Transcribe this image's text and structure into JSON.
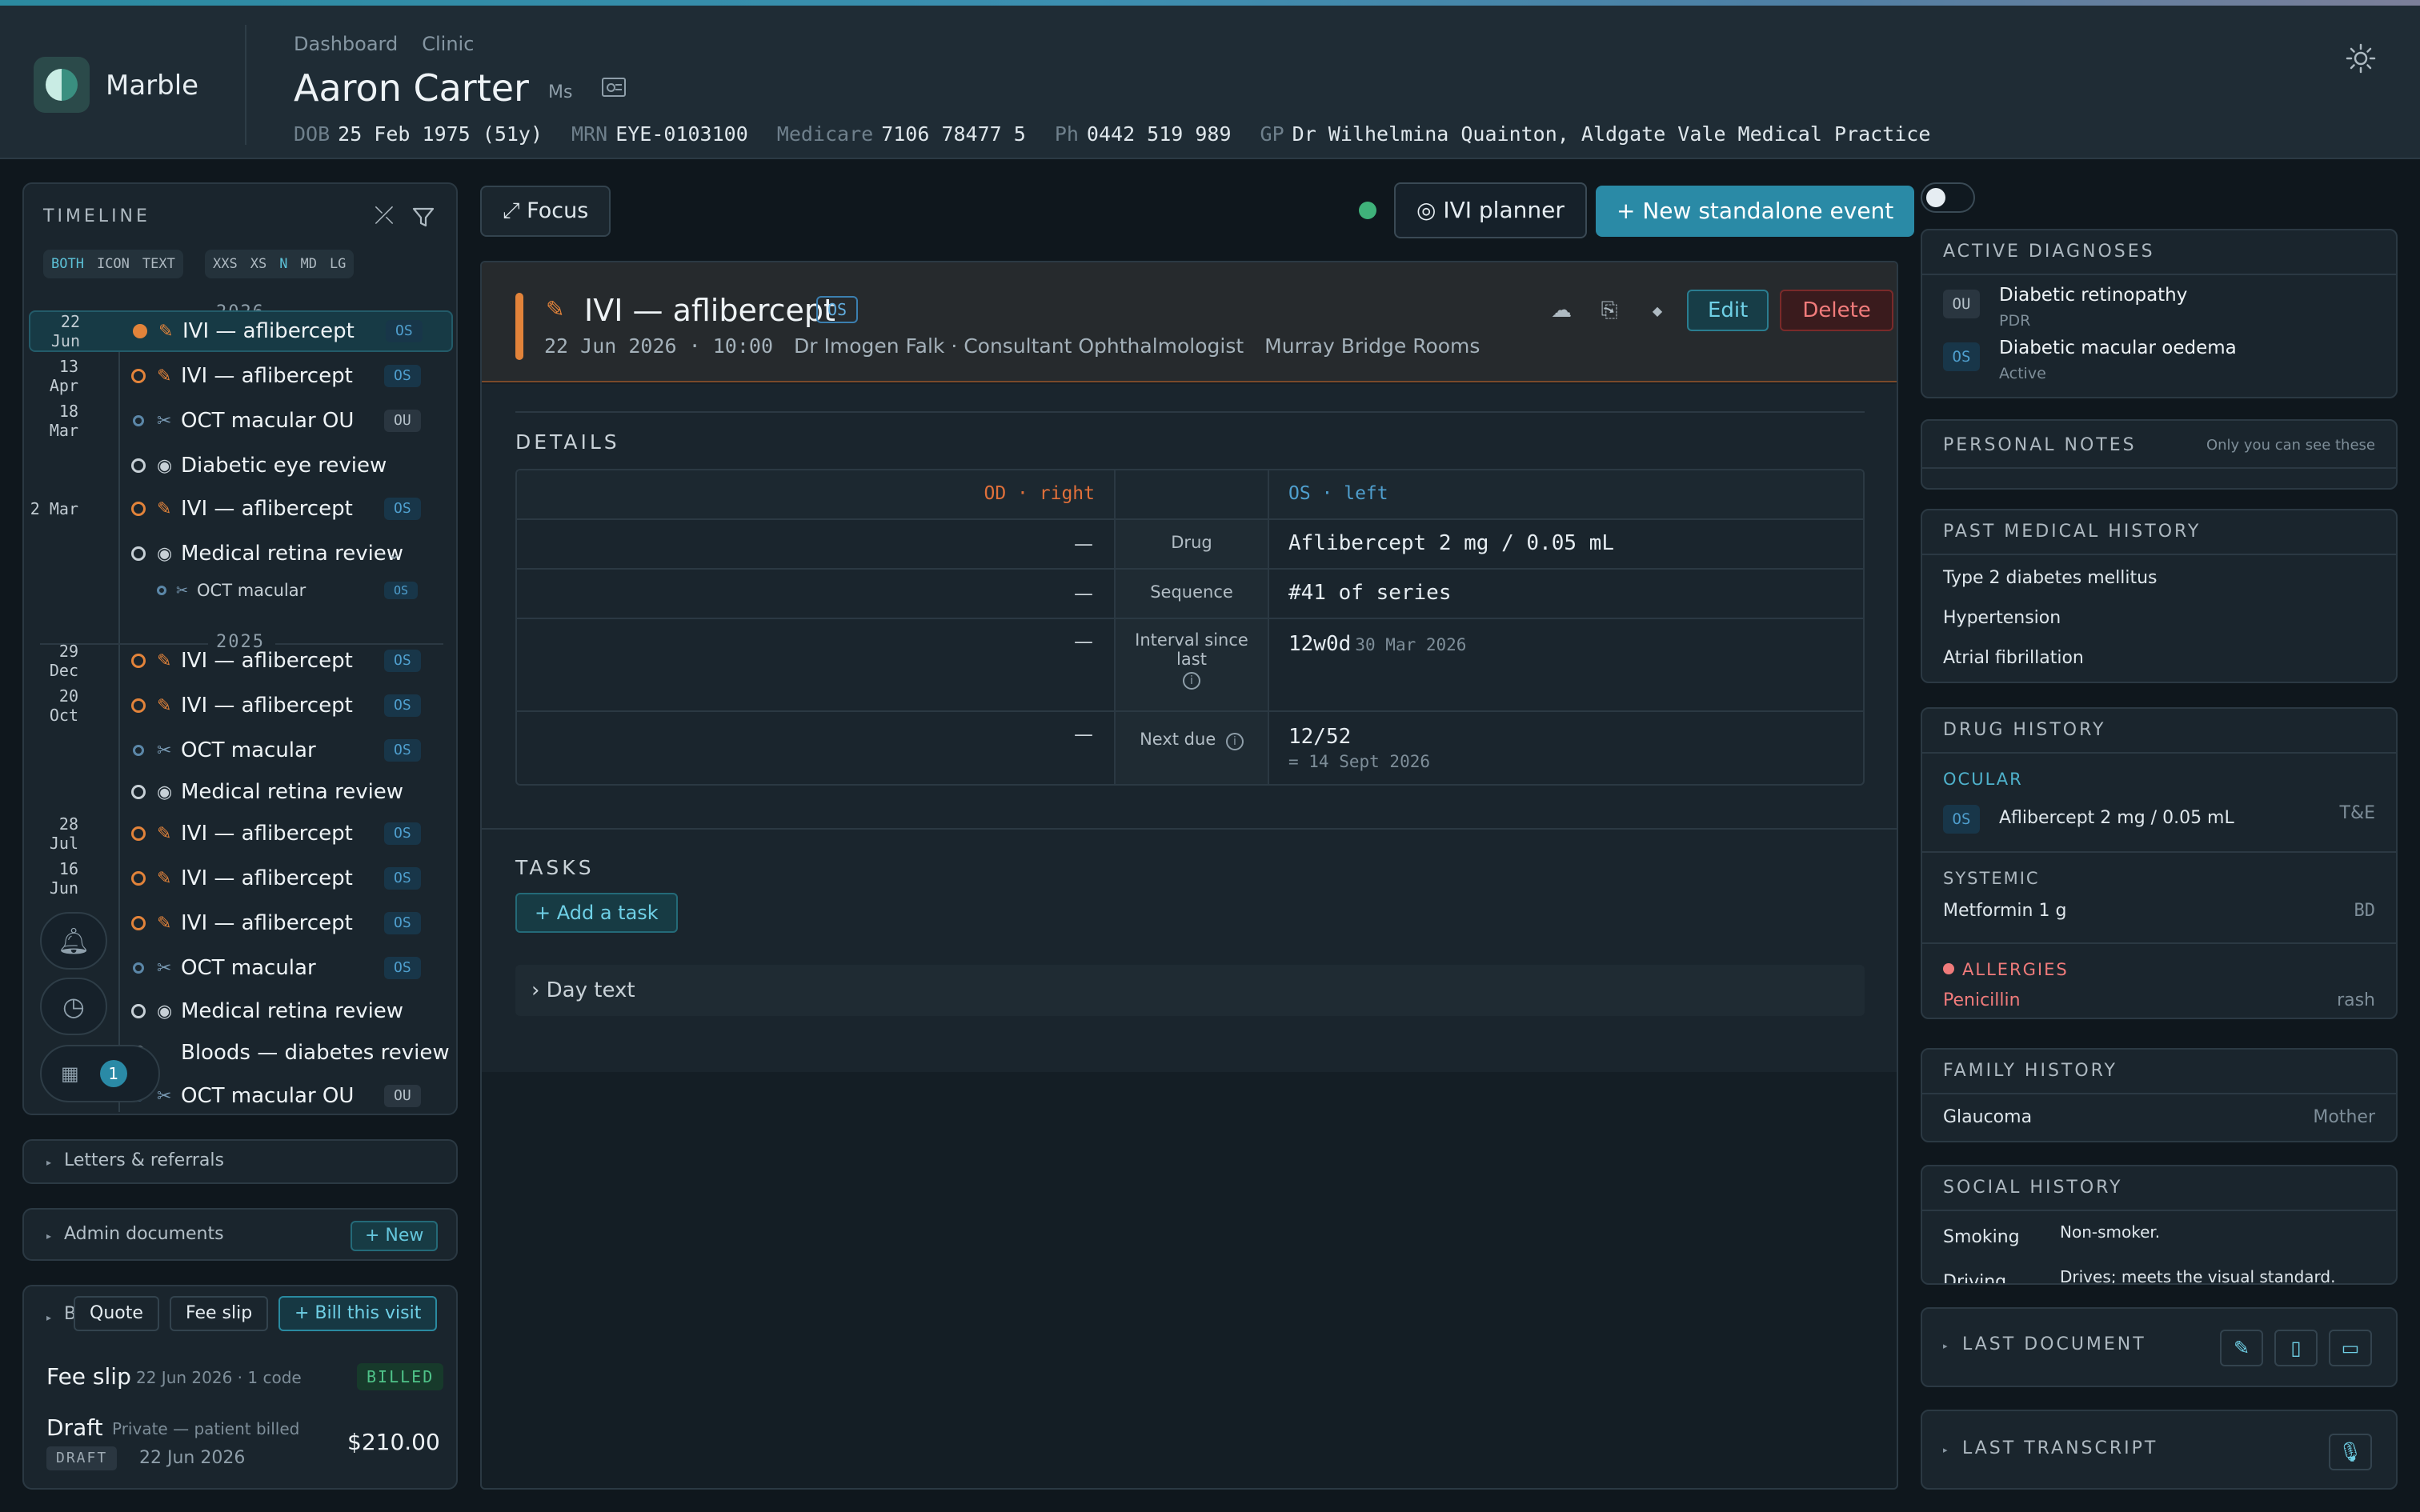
{
  "app": {
    "name": "Marble"
  },
  "breadcrumb": [
    "Dashboard",
    "Clinic"
  ],
  "patient": {
    "name": "Aaron Carter",
    "title": "Ms",
    "dob_label": "DOB",
    "dob": "25 Feb 1975 (51y)",
    "mrn_label": "MRN",
    "mrn": "EYE-0103100",
    "medicare_label": "Medicare",
    "medicare": "7106 78477 5",
    "ph_label": "Ph",
    "ph": "0442 519 989",
    "gp_label": "GP",
    "gp": "Dr Wilhelmina Quainton, Aldgate Vale Medical Practice"
  },
  "timeline": {
    "title": "TIMELINE",
    "mode_toggle": [
      "BOTH",
      "ICON",
      "TEXT"
    ],
    "mode_active": "BOTH",
    "size_toggle": [
      "XXS",
      "XS",
      "N",
      "MD",
      "LG"
    ],
    "size_active": "N",
    "year_2026": "2026",
    "year_2025": "2025",
    "items": [
      {
        "date": "22 Jun",
        "label": "IVI — aflibercept",
        "badge": "OS",
        "kind": "ivi",
        "selected": true
      },
      {
        "date": "13 Apr",
        "label": "IVI — aflibercept",
        "badge": "OS",
        "kind": "ivi"
      },
      {
        "date": "18 Mar",
        "label": "OCT macular OU",
        "badge": "OU",
        "kind": "oct"
      },
      {
        "date": "",
        "label": "Diabetic eye review",
        "badge": "",
        "kind": "review"
      },
      {
        "date": "2 Mar",
        "label": "IVI — aflibercept",
        "badge": "OS",
        "kind": "ivi"
      },
      {
        "date": "",
        "label": "Medical retina review",
        "badge": "",
        "kind": "review",
        "chevron": "⌄"
      },
      {
        "date": "",
        "label": "OCT macular",
        "badge": "OS",
        "kind": "oct-sub"
      },
      {
        "date": "29 Dec",
        "label": "IVI — aflibercept",
        "badge": "OS",
        "kind": "ivi"
      },
      {
        "date": "20 Oct",
        "label": "IVI — aflibercept",
        "badge": "OS",
        "kind": "ivi"
      },
      {
        "date": "",
        "label": "OCT macular",
        "badge": "OS",
        "kind": "oct"
      },
      {
        "date": "",
        "label": "Medical retina review",
        "badge": "",
        "kind": "review"
      },
      {
        "date": "28 Jul",
        "label": "IVI — aflibercept",
        "badge": "OS",
        "kind": "ivi"
      },
      {
        "date": "16 Jun",
        "label": "IVI — aflibercept",
        "badge": "OS",
        "kind": "ivi"
      },
      {
        "date": "",
        "label": "IVI — aflibercept",
        "badge": "OS",
        "kind": "ivi"
      },
      {
        "date": "",
        "label": "OCT macular",
        "badge": "OS",
        "kind": "oct"
      },
      {
        "date": "",
        "label": "Medical retina review",
        "badge": "",
        "kind": "review"
      },
      {
        "date": "",
        "label": "Bloods — diabetes review",
        "badge": "",
        "kind": "review"
      },
      {
        "date": "",
        "label": "OCT macular OU",
        "badge": "OU",
        "kind": "oct"
      }
    ],
    "calendar_count": "1"
  },
  "sections": {
    "letters": "Letters & referrals",
    "admin": "Admin documents",
    "admin_new": "+ New",
    "billing_letter": "B",
    "quote": "Quote",
    "fee_slip_btn": "Fee slip",
    "bill_visit": "+ Bill this visit"
  },
  "billing": {
    "fee_slip_title": "Fee slip",
    "fee_slip_meta": "22 Jun 2026 · 1 code",
    "fee_slip_status": "BILLED",
    "draft_title": "Draft",
    "draft_meta": "Private — patient billed",
    "draft_badge": "DRAFT",
    "draft_date": "22 Jun 2026",
    "draft_amount": "$210.00"
  },
  "toolbar": {
    "focus": "⤢ Focus",
    "ivi_planner": "◎ IVI planner",
    "new_event": "+ New standalone event"
  },
  "event": {
    "title": "IVI — aflibercept",
    "badge": "OS",
    "date": "22 Jun 2026",
    "time": "10:00",
    "clinician": "Dr Imogen Falk · Consultant Ophthalmologist",
    "location": "Murray Bridge Rooms",
    "edit": "Edit",
    "delete": "Delete"
  },
  "details": {
    "title": "DETAILS",
    "od_header": "OD · right",
    "os_header": "OS · left",
    "rows": [
      {
        "label": "Drug",
        "od": "—",
        "os": "Aflibercept 2 mg / 0.05 mL",
        "os_sub": ""
      },
      {
        "label": "Sequence",
        "od": "—",
        "os": "#41 of series",
        "os_sub": ""
      },
      {
        "label": "Interval since last",
        "od": "—",
        "os": "12w0d",
        "os_sub": "30 Mar 2026"
      },
      {
        "label": "Next due",
        "od": "—",
        "os": "12/52",
        "os_sub": "= 14 Sept 2026"
      }
    ]
  },
  "tasks": {
    "title": "TASKS",
    "add": "+ Add a task",
    "day_text": "› Day text"
  },
  "right": {
    "active_dx_title": "ACTIVE DIAGNOSES",
    "dx": [
      {
        "eye": "OU",
        "name": "Diabetic retinopathy",
        "sub": "PDR"
      },
      {
        "eye": "OS",
        "name": "Diabetic macular oedema",
        "sub": "Active"
      }
    ],
    "notes_title": "PERSONAL NOTES",
    "notes_hint": "Only you can see these",
    "pmh_title": "PAST MEDICAL HISTORY",
    "pmh": [
      "Type 2 diabetes mellitus",
      "Hypertension",
      "Atrial fibrillation"
    ],
    "drug_title": "DRUG HISTORY",
    "ocular_title": "OCULAR",
    "ocular_eye": "OS",
    "ocular_drug": "Aflibercept 2 mg / 0.05 mL",
    "ocular_freq": "T&E",
    "systemic_title": "SYSTEMIC",
    "systemic_drug": "Metformin 1 g",
    "systemic_freq": "BD",
    "allergy_title": "ALLERGIES",
    "allergy": "Penicillin",
    "allergy_reaction": "rash",
    "family_title": "FAMILY HISTORY",
    "family_item": "Glaucoma",
    "family_rel": "Mother",
    "social_title": "SOCIAL HISTORY",
    "smoking_label": "Smoking",
    "smoking_val": "Non-smoker.",
    "driving_label": "Driving",
    "driving_val": "Drives; meets the visual standard.",
    "last_doc": "LAST DOCUMENT",
    "last_transcript": "LAST TRANSCRIPT"
  },
  "colors": {
    "accent_teal": "#2a8aa6",
    "ivi_orange": "#e2833a",
    "os_blue": "#4f9fce",
    "od_orange": "#e0703a",
    "danger": "#f07b7b",
    "status_green": "#3fb27a"
  }
}
